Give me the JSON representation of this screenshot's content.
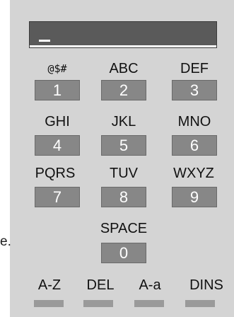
{
  "display": {
    "text": ""
  },
  "outside_text": "e.",
  "keypad": {
    "rows": [
      {
        "labels": [
          "@$#",
          "ABC",
          "DEF"
        ],
        "digits": [
          "1",
          "2",
          "3"
        ]
      },
      {
        "labels": [
          "GHI",
          "JKL",
          "MNO"
        ],
        "digits": [
          "4",
          "5",
          "6"
        ]
      },
      {
        "labels": [
          "PQRS",
          "TUV",
          "WXYZ"
        ],
        "digits": [
          "7",
          "8",
          "9"
        ]
      }
    ],
    "space_label": "SPACE",
    "zero": "0"
  },
  "bottom_keys": [
    "A-Z",
    "DEL",
    "A-a",
    "DINS"
  ]
}
